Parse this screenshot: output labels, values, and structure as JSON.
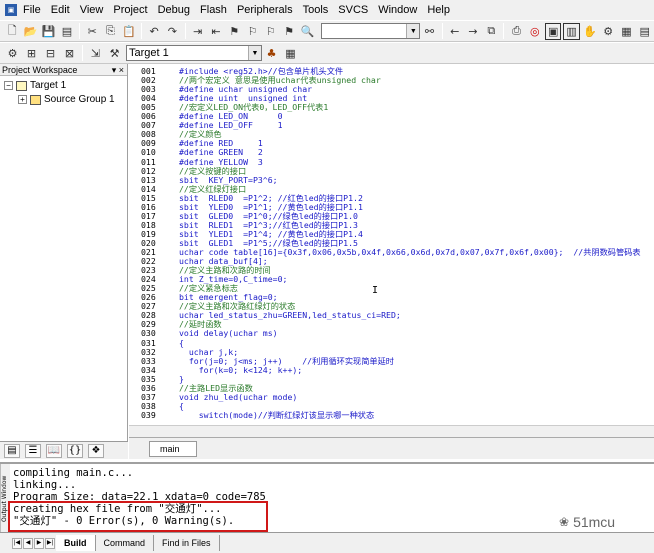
{
  "menu": [
    "File",
    "Edit",
    "View",
    "Project",
    "Debug",
    "Flash",
    "Peripherals",
    "Tools",
    "SVCS",
    "Window",
    "Help"
  ],
  "toolbar": {
    "target_value": "Target 1"
  },
  "workspace": {
    "title": "Project Workspace",
    "controls": "▾ ×",
    "target": "Target 1",
    "group": "Source Group 1"
  },
  "editor": {
    "tab": "main",
    "lines": [
      {
        "n": "001",
        "t": "#include <reg52.h>//包含单片机头文件"
      },
      {
        "n": "002",
        "t": "//两个宏定义 意思是使用uchar代表unsigned char"
      },
      {
        "n": "003",
        "t": "#define uchar unsigned char"
      },
      {
        "n": "004",
        "t": "#define uint  unsigned int"
      },
      {
        "n": "005",
        "t": "//宏定义LED_ON代表0，LED_OFF代表1"
      },
      {
        "n": "006",
        "t": "#define LED_ON      0"
      },
      {
        "n": "007",
        "t": "#define LED_OFF     1"
      },
      {
        "n": "008",
        "t": "//定义颜色"
      },
      {
        "n": "009",
        "t": "#define RED     1"
      },
      {
        "n": "010",
        "t": "#define GREEN   2"
      },
      {
        "n": "011",
        "t": "#define YELLOW  3"
      },
      {
        "n": "012",
        "t": "//定义按键的接口"
      },
      {
        "n": "013",
        "t": "sbit  KEY_PORT=P3^6;"
      },
      {
        "n": "014",
        "t": "//定义红绿灯接口"
      },
      {
        "n": "015",
        "t": "sbit  RLED0  =P1^2; //红色led的接口P1.2"
      },
      {
        "n": "016",
        "t": "sbit  YLED0  =P1^1; //黄色led的接口P1.1"
      },
      {
        "n": "017",
        "t": "sbit  GLED0  =P1^0;//绿色led的接口P1.0"
      },
      {
        "n": "018",
        "t": "sbit  RLED1  =P1^3;//红色led的接口P1.3"
      },
      {
        "n": "019",
        "t": "sbit  YLED1  =P1^4; //黄色led的接口P1.4"
      },
      {
        "n": "020",
        "t": "sbit  GLED1  =P1^5;//绿色led的接口P1.5"
      },
      {
        "n": "021",
        "t": "uchar code table[16]={0x3f,0x06,0x5b,0x4f,0x66,0x6d,0x7d,0x07,0x7f,0x6f,0x00};  //共阴数码管码表"
      },
      {
        "n": "022",
        "t": "uchar data_buf[4];"
      },
      {
        "n": "023",
        "t": "//定义主路和次路的时间"
      },
      {
        "n": "024",
        "t": "int Z_time=0,C_time=0;"
      },
      {
        "n": "025",
        "t": "//定义紧急标志"
      },
      {
        "n": "026",
        "t": "bit emergent_flag=0;"
      },
      {
        "n": "027",
        "t": "//定义主路和次路红绿灯的状态"
      },
      {
        "n": "028",
        "t": "uchar led_status_zhu=GREEN,led_status_ci=RED;"
      },
      {
        "n": "029",
        "t": "//延时函数"
      },
      {
        "n": "030",
        "t": "void delay(uchar ms)"
      },
      {
        "n": "031",
        "t": "{"
      },
      {
        "n": "032",
        "t": "  uchar j,k;"
      },
      {
        "n": "033",
        "t": "  for(j=0; j<ms; j++)    //利用循环实现简单延时"
      },
      {
        "n": "034",
        "t": "    for(k=0; k<124; k++);"
      },
      {
        "n": "035",
        "t": "}"
      },
      {
        "n": "036",
        "t": "//主路LED显示函数"
      },
      {
        "n": "037",
        "t": "void zhu_led(uchar mode)"
      },
      {
        "n": "038",
        "t": "{"
      },
      {
        "n": "039",
        "t": "    switch(mode)//判断红绿灯该显示哪一种状态"
      }
    ]
  },
  "output": {
    "lines": [
      "compiling main.c...",
      "linking...",
      "Program Size: data=22.1 xdata=0 code=785",
      "creating hex file from \"交通灯\"...",
      "\"交通灯\" - 0 Error(s), 0 Warning(s)."
    ],
    "side_label": "Output Window",
    "brand": "51mcu"
  },
  "output_tabs": [
    "Build",
    "Command",
    "Find in Files"
  ]
}
